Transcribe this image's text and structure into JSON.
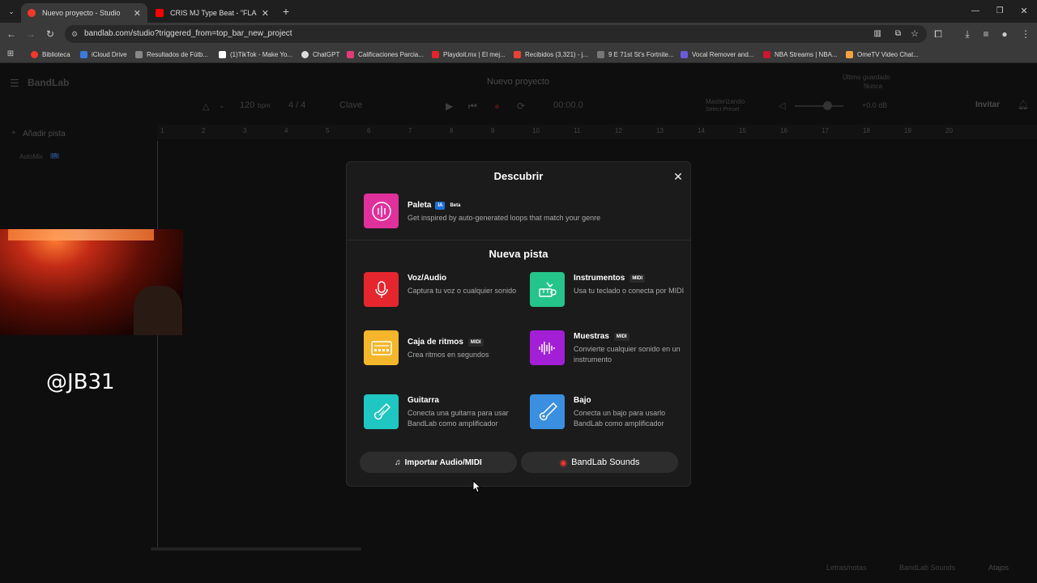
{
  "browser": {
    "tabs": [
      {
        "title": "Nuevo proyecto - Studio",
        "active": true,
        "favicon_color": "#f2372b"
      },
      {
        "title": "CRIS MJ Type Beat - \"FLAITE\"",
        "active": false,
        "favicon_color": "#ff0000"
      }
    ],
    "url": "bandlab.com/studio?triggered_from=top_bar_new_project",
    "bookmarks": [
      {
        "label": "Biblioteca",
        "color": "#f2372b"
      },
      {
        "label": "iCloud Drive",
        "color": "#3b7bd9"
      },
      {
        "label": "Resultados de Fútb...",
        "color": "#888"
      },
      {
        "label": "(1)TikTok - Make Yo...",
        "color": "#ffffff"
      },
      {
        "label": "ChatGPT",
        "color": "#dddddd"
      },
      {
        "label": "Calificaciones Parcia...",
        "color": "#e23b7a"
      },
      {
        "label": "Playdoit.mx | El mej...",
        "color": "#e3242b"
      },
      {
        "label": "Recibidos (3,321) - j...",
        "color": "#ea4335"
      },
      {
        "label": "9 E 71st St's Fortnite...",
        "color": "#777"
      },
      {
        "label": "Vocal Remover and...",
        "color": "#6b5bd6"
      },
      {
        "label": "NBA Streams | NBA...",
        "color": "#c9172e"
      },
      {
        "label": "OmeTV Video Chat...",
        "color": "#f4a340"
      }
    ]
  },
  "app": {
    "logo": "BandLab",
    "project_title": "Nuevo proyecto",
    "saved_label": "Último guardado",
    "saved_value": "Nunca",
    "bpm": "120",
    "bpm_unit": "bpm",
    "time_sig": "4 / 4",
    "key_label": "Clave",
    "time": "00:00.0",
    "mastering": "Masterizando",
    "mastering_sub": "Select Preset",
    "volume": "+0.0 dB",
    "invite": "Invitar",
    "add_track": "Añadir pista",
    "automix": "AutoMix",
    "automix_badge": "IA",
    "ruler": [
      "1",
      "2",
      "3",
      "4",
      "5",
      "6",
      "7",
      "8",
      "9",
      "10",
      "11",
      "12",
      "13",
      "14",
      "15",
      "16",
      "17",
      "18",
      "19",
      "20"
    ],
    "footer_right": [
      "Letras/notas",
      "BandLab Sounds",
      "Atajos"
    ]
  },
  "overlay": {
    "handle": "@JB31"
  },
  "modal": {
    "title": "Descubrir",
    "paleta": {
      "name": "Paleta",
      "badge_ia": "IA",
      "badge_beta": "Beta",
      "desc": "Get inspired by auto-generated loops that match your genre",
      "color": "#e0309c"
    },
    "section_title": "Nueva pista",
    "options": [
      {
        "name": "Voz/Audio",
        "badge": "",
        "desc": "Captura tu voz o cualquier sonido",
        "color": "#e5262e",
        "icon": "microphone-icon"
      },
      {
        "name": "Instrumentos",
        "badge": "MIDI",
        "desc": "Usa tu teclado o conecta por MIDI",
        "color": "#25c48a",
        "icon": "keyboard-icon"
      },
      {
        "name": "Caja de ritmos",
        "badge": "MIDI",
        "desc": "Crea ritmos en segundos",
        "color": "#f5b62b",
        "icon": "drum-machine-icon"
      },
      {
        "name": "Muestras",
        "badge": "MIDI",
        "desc": "Convierte cualquier sonido en un instrumento",
        "color": "#a21fd6",
        "icon": "waveform-icon"
      },
      {
        "name": "Guitarra",
        "badge": "",
        "desc": "Conecta una guitarra para usar BandLab como amplificador",
        "color": "#1fc6c2",
        "icon": "guitar-icon"
      },
      {
        "name": "Bajo",
        "badge": "",
        "desc": "Conecta un bajo para usarlo BandLab como amplificador",
        "color": "#3a8fe0",
        "icon": "bass-icon"
      }
    ],
    "import_button": "Importar Audio/MIDI",
    "sounds_button": "BandLab Sounds"
  }
}
